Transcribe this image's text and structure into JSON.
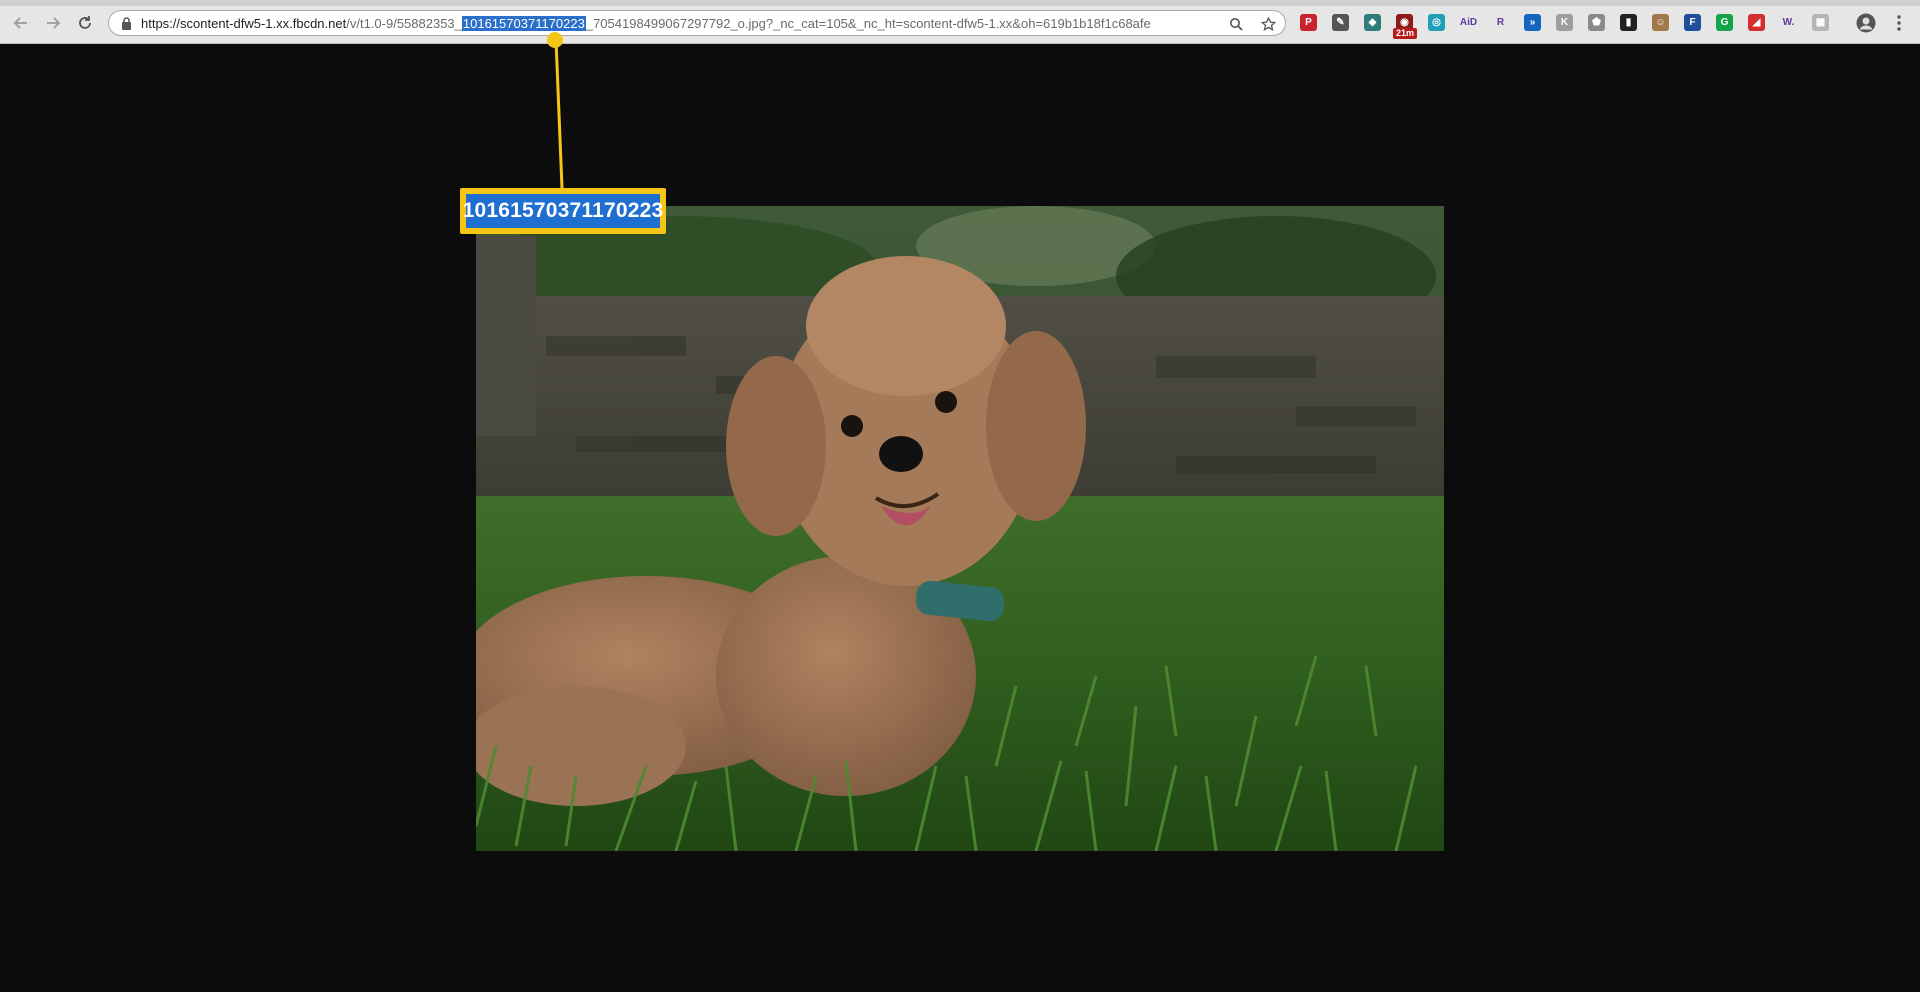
{
  "browser": {
    "url": {
      "host": "https://scontent-dfw5-1.xx.fbcdn.net",
      "path_before": "/v/t1.0-9/55882353_",
      "selected": "10161570371170223",
      "path_after": "_7054198499067297792_o.jpg?_nc_cat=105&_nc_ht=scontent-dfw5-1.xx&oh=619b1b18f1c68afe"
    },
    "extensions": [
      {
        "icon": "pinterest-icon",
        "color": "#c8232c",
        "glyph": "P"
      },
      {
        "icon": "eyedropper-icon",
        "color": "#555555",
        "glyph": "✎"
      },
      {
        "icon": "shield-icon",
        "color": "#2e7d7a",
        "glyph": "◆"
      },
      {
        "icon": "timer-icon",
        "color": "#8b1a1a",
        "glyph": "◉"
      },
      {
        "icon": "circle-ext-icon",
        "color": "#1e9fb5",
        "glyph": "◎"
      },
      {
        "icon": "aid-icon",
        "color": "#e8e8e8",
        "glyph": "AiD"
      },
      {
        "icon": "r-icon",
        "color": "#e8e8e8",
        "glyph": "R"
      },
      {
        "icon": "arrow-ext-icon",
        "color": "#1565c0",
        "glyph": "»"
      },
      {
        "icon": "k-icon",
        "color": "#9e9e9e",
        "glyph": "K"
      },
      {
        "icon": "gray-shield-icon",
        "color": "#8a8a8a",
        "glyph": "⬟"
      },
      {
        "icon": "bookmark-icon",
        "color": "#222222",
        "glyph": "▮"
      },
      {
        "icon": "face-icon",
        "color": "#a0784a",
        "glyph": "☺"
      },
      {
        "icon": "f-icon",
        "color": "#1f4f9a",
        "glyph": "F"
      },
      {
        "icon": "grammarly-icon",
        "color": "#15a34a",
        "glyph": "G"
      },
      {
        "icon": "red-tag-icon",
        "color": "#d32f2f",
        "glyph": "◢"
      },
      {
        "icon": "w-icon",
        "color": "#e8e8e8",
        "glyph": "W."
      },
      {
        "icon": "image-ext-icon",
        "color": "#b5b5b5",
        "glyph": "▦"
      }
    ],
    "timer_badge": "21m"
  },
  "callout": {
    "text": "10161570371170223",
    "border_color": "#f5c518",
    "fill_color": "#1f6fd1"
  },
  "image": {
    "icon": "dog-photo"
  }
}
